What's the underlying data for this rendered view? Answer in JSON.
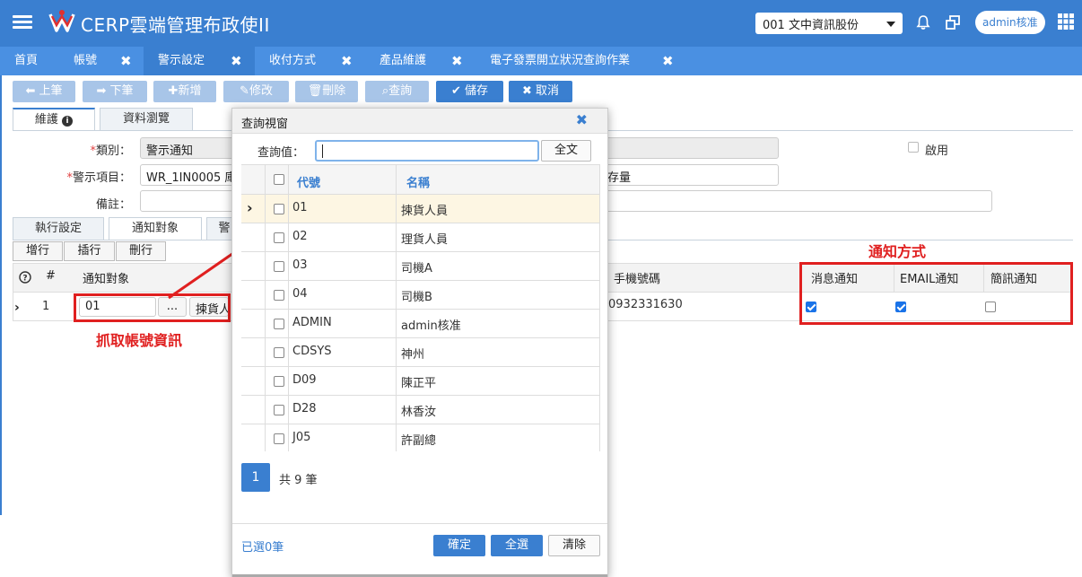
{
  "header": {
    "app_title": "CERP雲端管理布政使II",
    "company": "001 文中資訊股份",
    "user": "admin核准",
    "brand_color": "#3a7fd0"
  },
  "tabs": [
    {
      "label": "首頁"
    },
    {
      "label": "帳號"
    },
    {
      "label": "警示設定"
    },
    {
      "label": "收付方式"
    },
    {
      "label": "產品維護"
    },
    {
      "label": "電子發票開立狀況查詢作業"
    }
  ],
  "tab_close_glyph": "✖",
  "toolbar": {
    "prev": "上筆",
    "next": "下筆",
    "add": "新增",
    "edit": "修改",
    "delete": "刪除",
    "query": "查詢",
    "save": "儲存",
    "cancel": "取消"
  },
  "main_tabs": {
    "maintain": "維護",
    "browse": "資料瀏覽"
  },
  "form": {
    "category_label": "類別：",
    "category_value": "警示通知",
    "alert_item_label": "警示項目：",
    "alert_item_value": "WR_1IN0005 庫",
    "alert_item_tail": "存量",
    "remark_label": "備註：",
    "enabled_label": "啟用"
  },
  "sub_tabs": {
    "exec": "執行設定",
    "notify": "通知對象",
    "third": "警"
  },
  "grid_buttons": {
    "add_row": "增行",
    "insert_row": "插行",
    "delete_row": "刪行"
  },
  "grid": {
    "col_num": "#",
    "col_target": "通知對象",
    "col_phone": "手機號碼",
    "col_msg": "消息通知",
    "col_email": "EMAIL通知",
    "col_sms": "簡訊通知",
    "row_num": "1",
    "row_target": "01",
    "row_dots": "...",
    "row_target_name": "揀貨人",
    "row_phone": "0932331630",
    "row_msg": true,
    "row_email": true,
    "row_sms": false
  },
  "annotations": {
    "fetch_account": "抓取帳號資訊",
    "notify_method": "通知方式"
  },
  "dialog": {
    "title": "查詢視窗",
    "close": "✖",
    "query_label": "查詢值：",
    "query_value": "",
    "fulltext_btn": "全文",
    "col_code": "代號",
    "col_name": "名稱",
    "rows": [
      {
        "code": "01",
        "name": "揀貨人員"
      },
      {
        "code": "02",
        "name": "理貨人員"
      },
      {
        "code": "03",
        "name": "司機A"
      },
      {
        "code": "04",
        "name": "司機B"
      },
      {
        "code": "ADMIN",
        "name": "admin核准"
      },
      {
        "code": "CDSYS",
        "name": "神州"
      },
      {
        "code": "D09",
        "name": "陳正平"
      },
      {
        "code": "D28",
        "name": "林香汝"
      },
      {
        "code": "J05",
        "name": "許副總"
      }
    ],
    "page": "1",
    "total": "共 9 筆",
    "selected": "已選0筆",
    "confirm": "確定",
    "select_all": "全選",
    "clear": "清除"
  }
}
